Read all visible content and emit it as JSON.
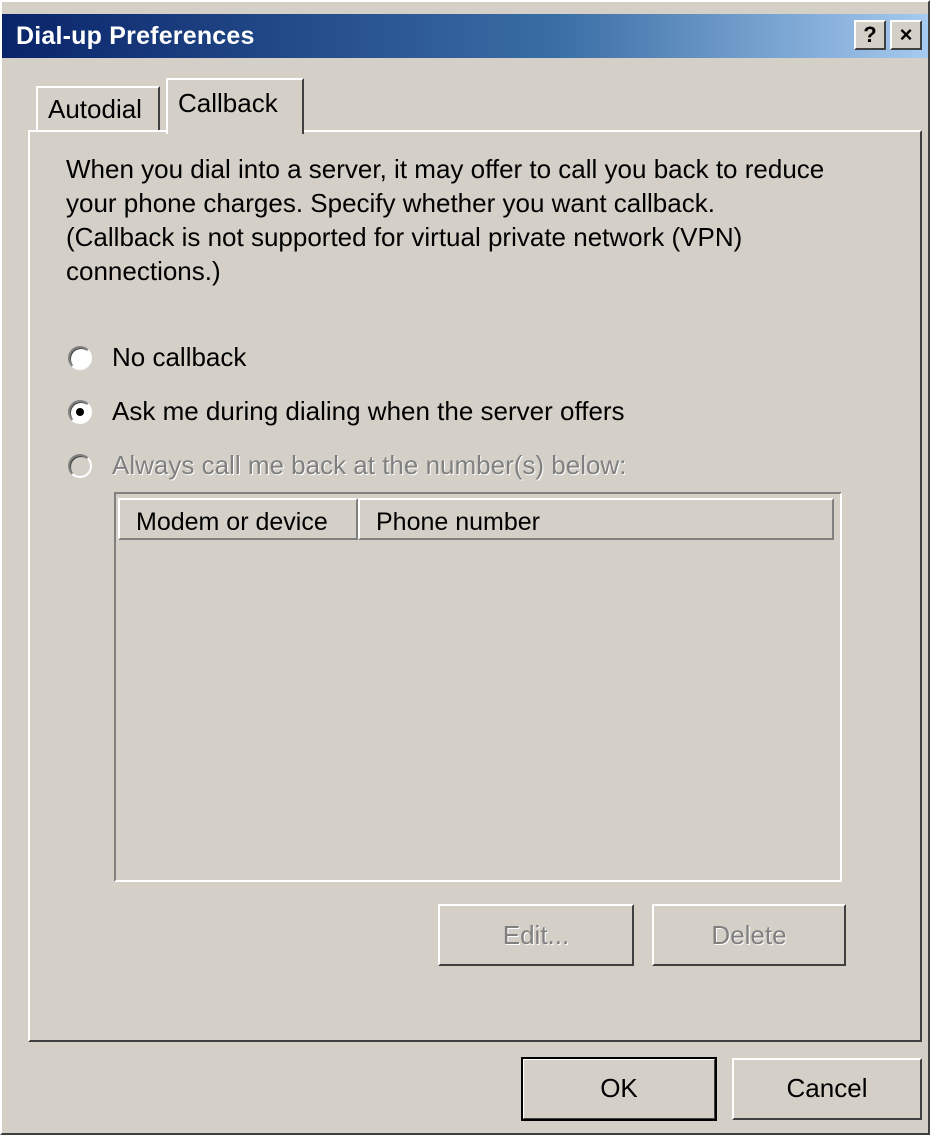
{
  "window": {
    "title": "Dial-up Preferences",
    "help_label": "?",
    "close_label": "×"
  },
  "tabs": [
    {
      "label": "Autodial",
      "active": false
    },
    {
      "label": "Callback",
      "active": true
    }
  ],
  "description_lines": [
    "When you dial into a server, it may offer to call you back to reduce",
    "your phone charges.  Specify whether you want callback.",
    "(Callback is not supported for virtual private network (VPN)",
    "connections.)"
  ],
  "options": [
    {
      "label": "No callback",
      "checked": false,
      "enabled": true
    },
    {
      "label": "Ask me during dialing when the server offers",
      "checked": true,
      "enabled": true
    },
    {
      "label": "Always call me back at the number(s) below:",
      "checked": false,
      "enabled": false
    }
  ],
  "list": {
    "columns": [
      "Modem or device",
      "Phone number"
    ],
    "rows": []
  },
  "buttons": {
    "edit": "Edit...",
    "delete": "Delete",
    "ok": "OK",
    "cancel": "Cancel"
  }
}
